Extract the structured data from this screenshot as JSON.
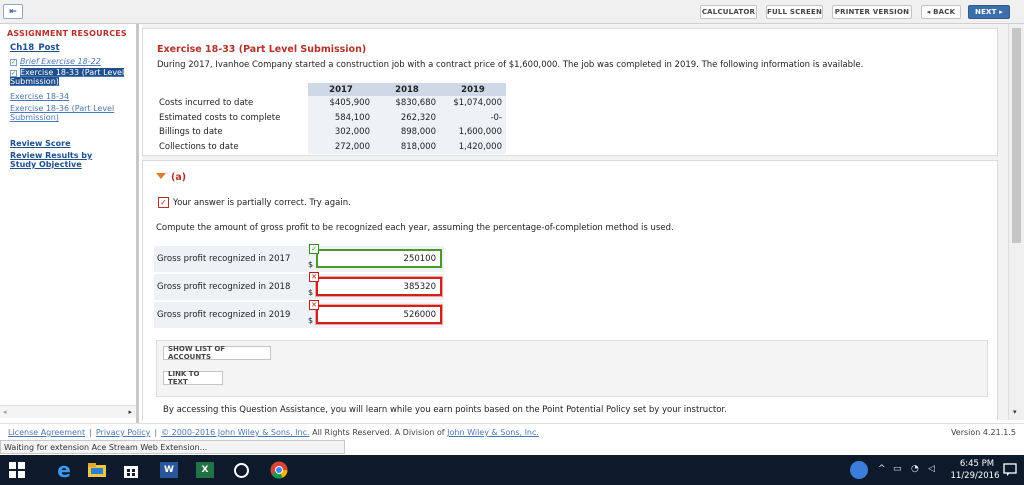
{
  "toolbar": {
    "calculator": "CALCULATOR",
    "full_screen": "FULL SCREEN",
    "printer_version": "PRINTER VERSION",
    "back": "◂ BACK",
    "next": "NEXT ▸"
  },
  "sidebar": {
    "title": "ASSIGNMENT RESOURCES",
    "chapter": "Ch18_Post",
    "items": [
      {
        "label": "Brief Exercise 18-22",
        "checked": true,
        "italic": true
      },
      {
        "label": "Exercise 18-33 (Part Level Submission)",
        "checked": true,
        "selected": true
      },
      {
        "label": "Exercise 18-34",
        "checked": false
      },
      {
        "label": "Exercise 18-36 (Part Level Submission)",
        "checked": false
      }
    ],
    "review_score": "Review Score",
    "review_results": "Review Results by Study Objective"
  },
  "exercise": {
    "title": "Exercise 18-33 (Part Level Submission)",
    "description": "During 2017, Ivanhoe Company started a construction job with a contract price of $1,600,000. The job was completed in 2019. The following information is available.",
    "table": {
      "columns": [
        "2017",
        "2018",
        "2019"
      ],
      "rows": [
        {
          "label": "Costs incurred to date",
          "values": [
            "$405,900",
            "$830,680",
            "$1,074,000"
          ]
        },
        {
          "label": "Estimated costs to complete",
          "values": [
            "584,100",
            "262,320",
            "-0-"
          ]
        },
        {
          "label": "Billings to date",
          "values": [
            "302,000",
            "898,000",
            "1,600,000"
          ]
        },
        {
          "label": "Collections to date",
          "values": [
            "272,000",
            "818,000",
            "1,420,000"
          ]
        }
      ]
    }
  },
  "part_a": {
    "label": "(a)",
    "status": "Your answer is partially correct.  Try again.",
    "instruction": "Compute the amount of gross profit to be recognized each year, assuming the percentage-of-completion method is used.",
    "answers": [
      {
        "label": "Gross profit recognized in 2017",
        "currency": "$",
        "value": "250100",
        "correct": true
      },
      {
        "label": "Gross profit recognized in 2018",
        "currency": "$",
        "value": "385320",
        "correct": false
      },
      {
        "label": "Gross profit recognized in 2019",
        "currency": "$",
        "value": "526000",
        "correct": false
      }
    ],
    "show_accounts": "SHOW LIST OF ACCOUNTS",
    "link_to_text": "LINK TO TEXT",
    "assistance": "By accessing this Question Assistance, you will learn while you earn points based on the Point Potential Policy set by your instructor."
  },
  "footer": {
    "license": "License Agreement",
    "privacy": "Privacy Policy",
    "copyright": "© 2000-2016 John Wiley & Sons, Inc.",
    "rights": "All Rights Reserved. A Division of",
    "company": "John Wiley & Sons, Inc.",
    "version": "Version 4.21.1.5"
  },
  "browser_status": "Waiting for extension Ace Stream Web Extension...",
  "taskbar": {
    "time": "6:45 PM",
    "date": "11/29/2016"
  }
}
